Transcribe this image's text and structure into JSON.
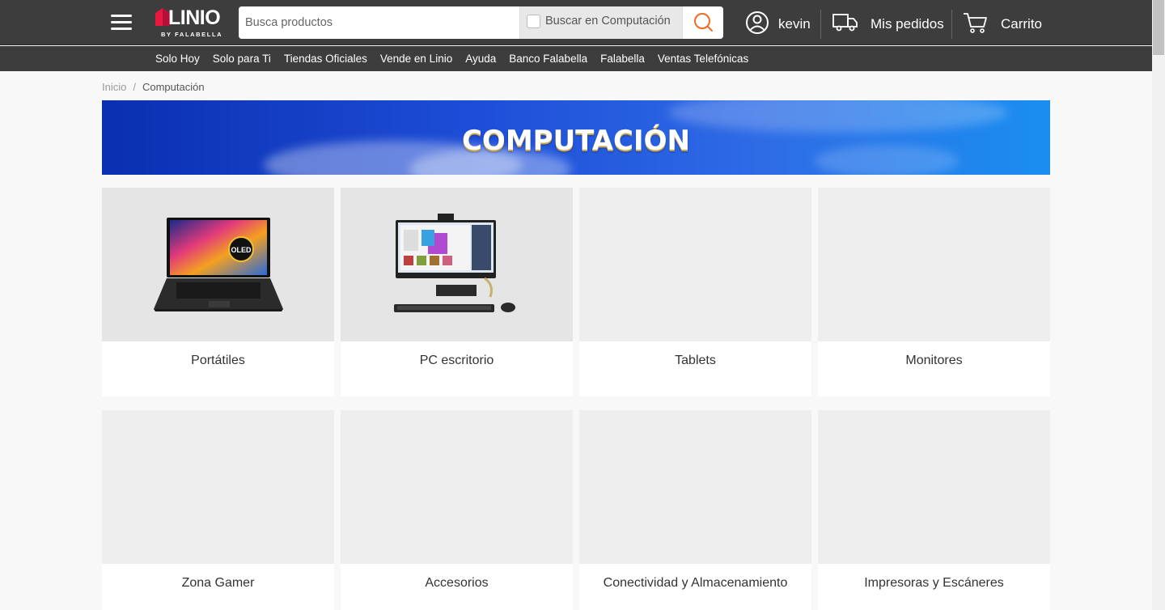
{
  "header": {
    "logo_text": "LINIO",
    "logo_sub": "BY FALABELLA",
    "search_placeholder": "Busca productos",
    "search_filter_label": "Buscar en Computación",
    "user_label": "kevin",
    "orders_label": "Mis pedidos",
    "cart_label": "Carrito"
  },
  "nav": {
    "items": [
      "Solo Hoy",
      "Solo para Ti",
      "Tiendas Oficiales",
      "Vende en Linio",
      "Ayuda",
      "Banco Falabella",
      "Falabella",
      "Ventas Telefónicas"
    ]
  },
  "breadcrumb": {
    "home": "Inicio",
    "separator": "/",
    "current": "Computación"
  },
  "banner": {
    "title": "COMPUTACIÓN"
  },
  "categories": [
    {
      "label": "Portátiles",
      "image": "laptop-oled"
    },
    {
      "label": "PC escritorio",
      "image": "all-in-one-desktop"
    },
    {
      "label": "Tablets",
      "image": ""
    },
    {
      "label": "Monitores",
      "image": ""
    },
    {
      "label": "Zona Gamer",
      "image": ""
    },
    {
      "label": "Accesorios",
      "image": ""
    },
    {
      "label": "Conectividad y Almacenamiento",
      "image": ""
    },
    {
      "label": "Impresoras y Escáneres",
      "image": ""
    }
  ],
  "laptop_badge": "OLED",
  "colors": {
    "header_bg": "#3d3d3d",
    "search_accent": "#f26b21",
    "logo_accent": "#e8193c"
  }
}
